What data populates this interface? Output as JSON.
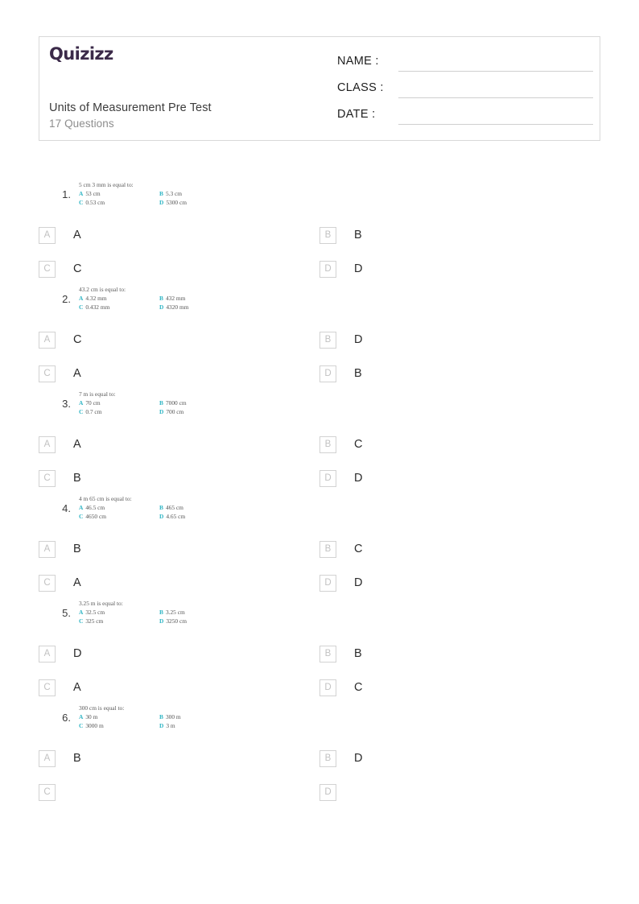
{
  "header": {
    "logo_text": "Quizizz",
    "title": "Units of Measurement Pre Test",
    "question_count": "17 Questions",
    "fields": [
      {
        "label": "NAME :",
        "value": ""
      },
      {
        "label": "CLASS :",
        "value": ""
      },
      {
        "label": "DATE  :",
        "value": ""
      }
    ]
  },
  "colors": {
    "logo": "#3b2a49",
    "option_letter": "#2fb5c4",
    "box_border": "#d2d2d2",
    "box_letter": "#c2c2c2",
    "header_border": "#d9d9d9",
    "subtitle": "#8d8d8d"
  },
  "questions": [
    {
      "number": "1.",
      "image": {
        "prompt": "5 cm 3 mm is equal to:",
        "options": [
          {
            "letter": "A",
            "text": "53 cm"
          },
          {
            "letter": "B",
            "text": "5.3 cm"
          },
          {
            "letter": "C",
            "text": "0.53 cm"
          },
          {
            "letter": "D",
            "text": "5300 cm"
          }
        ]
      },
      "choices": [
        {
          "box": "A",
          "text": "A"
        },
        {
          "box": "B",
          "text": "B"
        },
        {
          "box": "C",
          "text": "C"
        },
        {
          "box": "D",
          "text": "D"
        }
      ]
    },
    {
      "number": "2.",
      "image": {
        "prompt": "43.2 cm is equal to:",
        "options": [
          {
            "letter": "A",
            "text": "4.32 mm"
          },
          {
            "letter": "B",
            "text": "432 mm"
          },
          {
            "letter": "C",
            "text": "0.432 mm"
          },
          {
            "letter": "D",
            "text": "4320 mm"
          }
        ]
      },
      "choices": [
        {
          "box": "A",
          "text": "C"
        },
        {
          "box": "B",
          "text": "D"
        },
        {
          "box": "C",
          "text": "A"
        },
        {
          "box": "D",
          "text": "B"
        }
      ]
    },
    {
      "number": "3.",
      "image": {
        "prompt": "7 m is equal to:",
        "options": [
          {
            "letter": "A",
            "text": "70 cm"
          },
          {
            "letter": "B",
            "text": "7000 cm"
          },
          {
            "letter": "C",
            "text": "0.7 cm"
          },
          {
            "letter": "D",
            "text": "700 cm"
          }
        ]
      },
      "choices": [
        {
          "box": "A",
          "text": "A"
        },
        {
          "box": "B",
          "text": "C"
        },
        {
          "box": "C",
          "text": "B"
        },
        {
          "box": "D",
          "text": "D"
        }
      ]
    },
    {
      "number": "4.",
      "image": {
        "prompt": "4 m 65 cm is equal to:",
        "options": [
          {
            "letter": "A",
            "text": "46.5 cm"
          },
          {
            "letter": "B",
            "text": "465 cm"
          },
          {
            "letter": "C",
            "text": "4650 cm"
          },
          {
            "letter": "D",
            "text": "4.65 cm"
          }
        ]
      },
      "choices": [
        {
          "box": "A",
          "text": "B"
        },
        {
          "box": "B",
          "text": "C"
        },
        {
          "box": "C",
          "text": "A"
        },
        {
          "box": "D",
          "text": "D"
        }
      ]
    },
    {
      "number": "5.",
      "image": {
        "prompt": "3.25 m is equal to:",
        "options": [
          {
            "letter": "A",
            "text": "32.5 cm"
          },
          {
            "letter": "B",
            "text": "3.25 cm"
          },
          {
            "letter": "C",
            "text": "325 cm"
          },
          {
            "letter": "D",
            "text": "3250 cm"
          }
        ]
      },
      "choices": [
        {
          "box": "A",
          "text": "D"
        },
        {
          "box": "B",
          "text": "B"
        },
        {
          "box": "C",
          "text": "A"
        },
        {
          "box": "D",
          "text": "C"
        }
      ]
    },
    {
      "number": "6.",
      "image": {
        "prompt": "300 cm is equal to:",
        "options": [
          {
            "letter": "A",
            "text": "30 m"
          },
          {
            "letter": "B",
            "text": "300 m"
          },
          {
            "letter": "C",
            "text": "3000 m"
          },
          {
            "letter": "D",
            "text": "3 m"
          }
        ]
      },
      "choices": [
        {
          "box": "A",
          "text": "B"
        },
        {
          "box": "B",
          "text": "D"
        },
        {
          "box": "C",
          "text": "",
          "hidden": true
        },
        {
          "box": "D",
          "text": "",
          "hidden": true
        }
      ]
    }
  ]
}
